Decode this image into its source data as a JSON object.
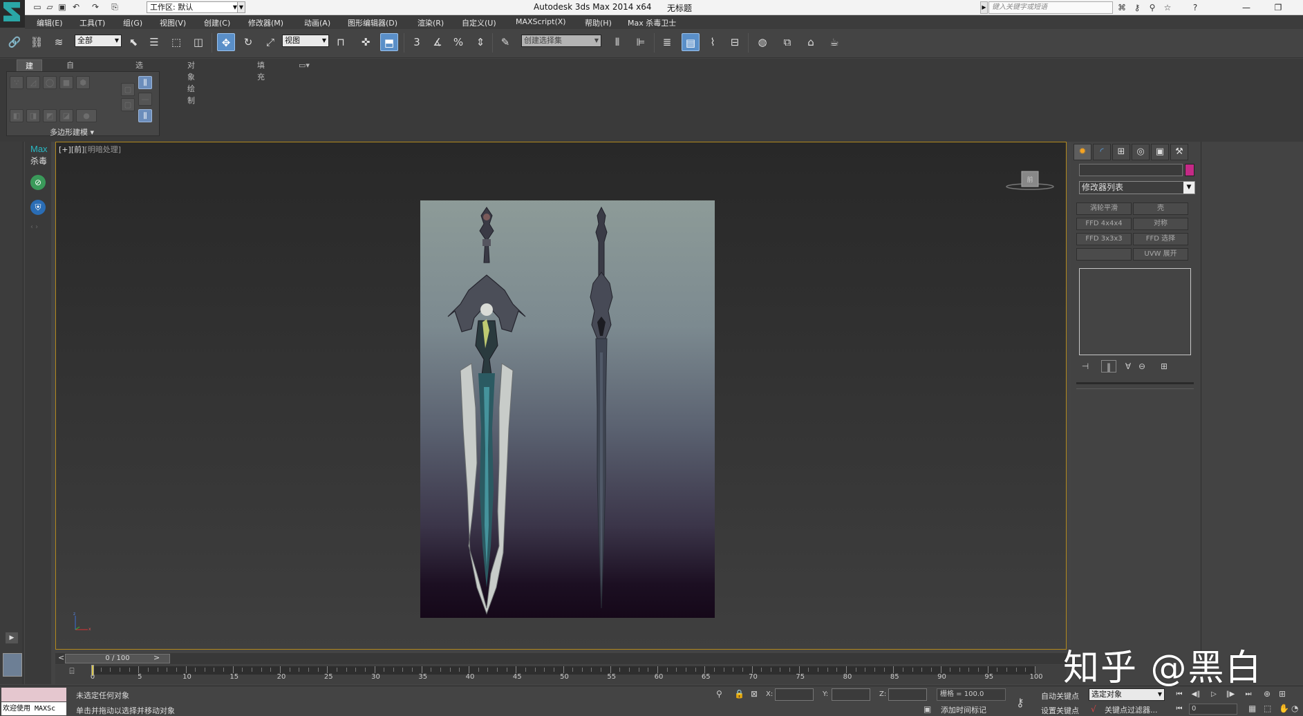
{
  "titlebar": {
    "workspace": "工作区: 默认",
    "app_title": "Autodesk 3ds Max  2014 x64",
    "doc_title": "无标题",
    "search_placeholder": "键入关键字或短语"
  },
  "menus": [
    "编辑(E)",
    "工具(T)",
    "组(G)",
    "视图(V)",
    "创建(C)",
    "修改器(M)",
    "动画(A)",
    "图形编辑器(D)",
    "渲染(R)",
    "自定义(U)",
    "MAXScript(X)",
    "帮助(H)",
    "Max 杀毒卫士"
  ],
  "toolbar": {
    "selection_filter": "全部",
    "ref_coord": "视图",
    "named_selection": "创建选择集",
    "snap_3": "3",
    "percent_snap": "%"
  },
  "ribbon": {
    "tabs": [
      "建模",
      "自由形式",
      "选择",
      "对象绘制",
      "填充"
    ],
    "panel_label": "多边形建模"
  },
  "antivirus": {
    "max": "Max",
    "sha": "杀毒"
  },
  "viewport": {
    "label_plus": "[+]",
    "label_view": "[前]",
    "label_shading": "[明暗处理]"
  },
  "command_panel": {
    "modifier_list": "修改器列表",
    "modifier_buttons": [
      [
        "涡轮平滑",
        "壳"
      ],
      [
        "FFD 4x4x4",
        "对称"
      ],
      [
        "FFD 3x3x3",
        "FFD 选择"
      ],
      [
        "",
        "UVW 展开"
      ]
    ]
  },
  "timeline": {
    "frame_display": "0 / 100",
    "ticks": [
      "0",
      "5",
      "10",
      "15",
      "20",
      "25",
      "30",
      "35",
      "40",
      "45",
      "50",
      "55",
      "60",
      "65",
      "70",
      "75",
      "80",
      "85",
      "90",
      "95",
      "100"
    ]
  },
  "statusbar": {
    "maxscript_welcome": "欢迎使用 MAXSc",
    "line1": "未选定任何对象",
    "line2": "单击并拖动以选择并移动对象",
    "x_label": "X:",
    "y_label": "Y:",
    "z_label": "Z:",
    "grid": "栅格 = 100.0",
    "add_time_tag": "添加时间标记",
    "auto_key": "自动关键点",
    "set_key": "设置关键点",
    "selected_object": "选定对象",
    "key_filters": "关键点过滤器...",
    "current_frame": "0"
  },
  "watermark": "知乎 @黑白",
  "colors": {
    "accent_blue": "#5a8fc8",
    "viewport_border": "#b48a1d",
    "color_swatch": "#c42a86",
    "brand_teal": "#29b9c4"
  }
}
